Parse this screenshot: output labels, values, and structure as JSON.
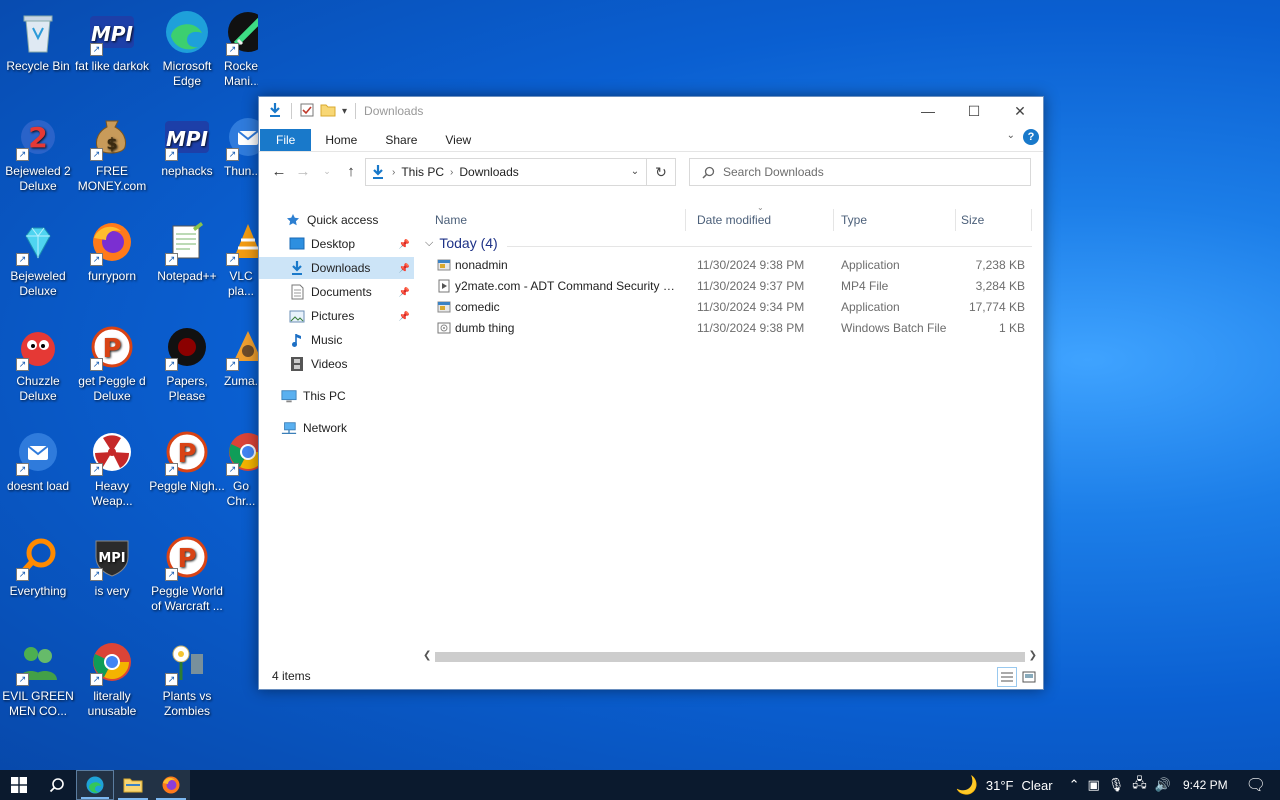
{
  "desktop": {
    "icons": [
      {
        "label": "Recycle Bin",
        "glyph": "recycle-bin-icon"
      },
      {
        "label": "fat like darkok",
        "glyph": "mpi-icon"
      },
      {
        "label": "Microsoft Edge",
        "glyph": "edge-icon"
      },
      {
        "label": "Rocket Mani...",
        "glyph": "rocket-icon"
      },
      {
        "label": "Bejeweled 2 Deluxe",
        "glyph": "bejeweled2-icon"
      },
      {
        "label": "FREE MONEY.com",
        "glyph": "money-bag-icon"
      },
      {
        "label": "nephacks",
        "glyph": "mpi-icon"
      },
      {
        "label": "Thun...",
        "glyph": "thunderbird-icon"
      },
      {
        "label": "Bejeweled Deluxe",
        "glyph": "gem-icon"
      },
      {
        "label": "furryporn",
        "glyph": "firefox-icon"
      },
      {
        "label": "Notepad++",
        "glyph": "notepad-icon"
      },
      {
        "label": "VLC pla...",
        "glyph": "vlc-icon"
      },
      {
        "label": "Chuzzle Deluxe",
        "glyph": "chuzzle-icon"
      },
      {
        "label": "get Peggle d Deluxe",
        "glyph": "peggle-icon"
      },
      {
        "label": "Papers, Please",
        "glyph": "papers-please-icon"
      },
      {
        "label": "Zuma...",
        "glyph": "zuma-icon"
      },
      {
        "label": "doesnt load",
        "glyph": "thunderbird-icon"
      },
      {
        "label": "Heavy Weap...",
        "glyph": "radiation-icon"
      },
      {
        "label": "Peggle Nigh...",
        "glyph": "peggle-icon"
      },
      {
        "label": "Go Chr...",
        "glyph": "chrome-icon"
      },
      {
        "label": "Everything",
        "glyph": "magnifier-icon"
      },
      {
        "label": "is very",
        "glyph": "mpi-shield-icon"
      },
      {
        "label": "Peggle World of Warcraft ...",
        "glyph": "peggle-icon"
      },
      {
        "label": "EVIL GREEN MEN CO...",
        "glyph": "green-men-icon"
      },
      {
        "label": "literally unusable",
        "glyph": "chrome-icon"
      },
      {
        "label": "Plants vs Zombies",
        "glyph": "pvz-icon"
      }
    ]
  },
  "explorer": {
    "title": "Downloads",
    "ribbon_tabs": [
      "File",
      "Home",
      "Share",
      "View"
    ],
    "help_label": "?",
    "address": {
      "crumbs": [
        "This PC",
        "Downloads"
      ]
    },
    "search": {
      "placeholder": "Search Downloads"
    },
    "nav": {
      "quick_access": "Quick access",
      "items": [
        {
          "label": "Desktop",
          "pinned": true
        },
        {
          "label": "Downloads",
          "pinned": true,
          "selected": true
        },
        {
          "label": "Documents",
          "pinned": true
        },
        {
          "label": "Pictures",
          "pinned": true
        },
        {
          "label": "Music",
          "pinned": false
        },
        {
          "label": "Videos",
          "pinned": false
        }
      ],
      "this_pc": "This PC",
      "network": "Network"
    },
    "columns": {
      "name": "Name",
      "date": "Date modified",
      "type": "Type",
      "size": "Size"
    },
    "group_label": "Today (4)",
    "files": [
      {
        "name": "nonadmin",
        "date": "11/30/2024 9:38 PM",
        "type": "Application",
        "size": "7,238 KB",
        "icon": "application-icon"
      },
      {
        "name": "y2mate.com - ADT Command Security S...",
        "date": "11/30/2024 9:37 PM",
        "type": "MP4 File",
        "size": "3,284 KB",
        "icon": "video-file-icon"
      },
      {
        "name": "comedic",
        "date": "11/30/2024 9:34 PM",
        "type": "Application",
        "size": "17,774 KB",
        "icon": "application-icon"
      },
      {
        "name": "dumb thing",
        "date": "11/30/2024 9:38 PM",
        "type": "Windows Batch File",
        "size": "1 KB",
        "icon": "batch-file-icon"
      }
    ],
    "status": "4 items"
  },
  "taskbar": {
    "weather_temp": "31°F",
    "weather_cond": "Clear",
    "clock": "9:42 PM"
  },
  "colors": {
    "accent": "#1979ca",
    "selection": "#cce4f7",
    "taskbar": "#0b1a2e"
  }
}
